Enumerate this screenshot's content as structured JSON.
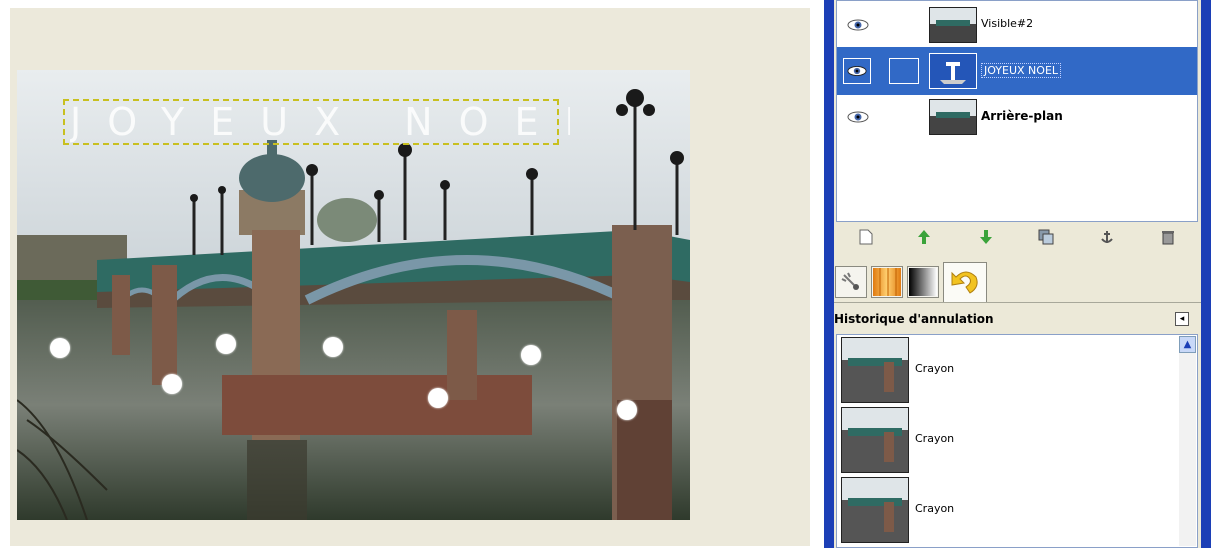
{
  "canvas": {
    "text_layer_content": "JOYEUX NOEL"
  },
  "layers": {
    "items": [
      {
        "name": "Visible#2"
      },
      {
        "name": "JOYEUX NOEL"
      },
      {
        "name": "Arrière-plan"
      }
    ],
    "buttons": [
      {
        "icon": "new-layer-icon"
      },
      {
        "icon": "raise-layer-icon"
      },
      {
        "icon": "lower-layer-icon"
      },
      {
        "icon": "duplicate-layer-icon"
      },
      {
        "icon": "anchor-layer-icon"
      },
      {
        "icon": "delete-layer-icon"
      }
    ]
  },
  "tabs": [
    {
      "icon": "tool-options-icon"
    },
    {
      "icon": "patterns-icon"
    },
    {
      "icon": "gradients-icon"
    },
    {
      "icon": "undo-history-icon"
    }
  ],
  "history": {
    "title": "Historique d'annulation",
    "items": [
      {
        "label": "Crayon"
      },
      {
        "label": "Crayon"
      },
      {
        "label": "Crayon"
      }
    ]
  },
  "colors": {
    "selection": "#3169c6",
    "dock_border": "#1c3fb6",
    "canvas_bg": "#ece9db"
  }
}
